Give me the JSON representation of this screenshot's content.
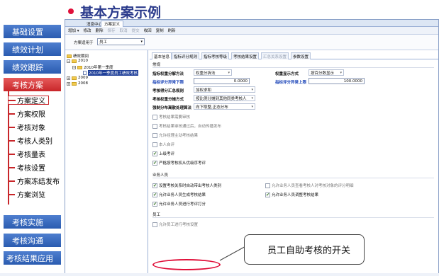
{
  "title": "基本方案示例",
  "sidebar": {
    "nav": [
      {
        "label": "基础设置"
      },
      {
        "label": "绩效计划"
      },
      {
        "label": "绩效跟踪"
      },
      {
        "label": "考核方案"
      },
      {
        "label": "考核实施"
      },
      {
        "label": "考核沟通"
      },
      {
        "label": "考核结果应用"
      }
    ],
    "sub": [
      {
        "label": "方案定义"
      },
      {
        "label": "方案权限"
      },
      {
        "label": "考核对象"
      },
      {
        "label": "考核人类别"
      },
      {
        "label": "考核量表"
      },
      {
        "label": "考核设置"
      },
      {
        "label": "方案冻结发布"
      },
      {
        "label": "方案浏览"
      }
    ]
  },
  "app": {
    "tabs": [
      "消息中心",
      "方案定义"
    ],
    "toolbar": [
      "增加 ▾",
      "修改",
      "删除",
      "保存",
      "取消",
      "提交",
      "收回",
      "复制",
      "刷新"
    ],
    "apply": {
      "label": "方案适用于",
      "value": "员工"
    },
    "tree": {
      "root": "绩效期间",
      "y2010": "2010",
      "q1": "2010年第一季度",
      "plan": "2010年一季度员工绩效考核",
      "y2009": "2009",
      "y2008": "2008"
    },
    "content_tabs": [
      "基本信息",
      "指标评分规则",
      "指标考核等级",
      "考核结果设置",
      "汇总关系设置",
      "参数设置"
    ],
    "sections": {
      "general": "常规",
      "staff": "业务人员",
      "employee": "员工"
    },
    "fields": {
      "calc_method_label": "指标权重分解方法",
      "calc_method_value": "权重分拆法",
      "weight_display_label": "权重显示方式",
      "weight_display_value": "按百分数显示",
      "score_lower_label": "指标评分异常下限",
      "score_lower_value": "0.0000",
      "score_upper_label": "指标评分异常上限",
      "score_upper_value": "100.0000",
      "summary_rule_label": "考核得分汇总规则",
      "summary_rule_value": "加权求和",
      "weight_alloc_label": "考核权重分摊方式",
      "weight_alloc_value": "按比例分摊到其他同类考核人",
      "forced_dist_label": "强制分布离散处理算法",
      "forced_dist_value": "向下取整,正态分布"
    },
    "checkboxes_general": [
      {
        "label": "考核结果需要审核",
        "checked": false
      },
      {
        "label": "考核结果审核通过后，自动传播发布",
        "checked": false
      },
      {
        "label": "允许经理主动考核结果",
        "checked": false
      },
      {
        "label": "本人自评",
        "checked": false
      },
      {
        "label": "上级考评",
        "checked": true
      },
      {
        "label": "严格按考核权从优级序考评",
        "checked": true
      }
    ],
    "checkboxes_staff": [
      {
        "label": "设置考核关系时自动带出考核人类别",
        "checked": true
      },
      {
        "label": "允许业务人员生成考核结果",
        "checked": true
      },
      {
        "label": "允许业务人员进行考评打分",
        "checked": true
      },
      {
        "label": "允许业务人员查看考核人对考核对象的评分明细",
        "checked": false
      },
      {
        "label": "允许业务人员调整考核结果",
        "checked": true
      }
    ],
    "checkboxes_employee": [
      {
        "label": "允许员工进行考核设置",
        "checked": false
      }
    ]
  },
  "callout": "员工自助考核的开关",
  "colors": {
    "accent_red": "#e0103a",
    "nav_blue": "#2a5bb0",
    "active_red": "#c8262a",
    "link_blue": "#1b44b8"
  }
}
